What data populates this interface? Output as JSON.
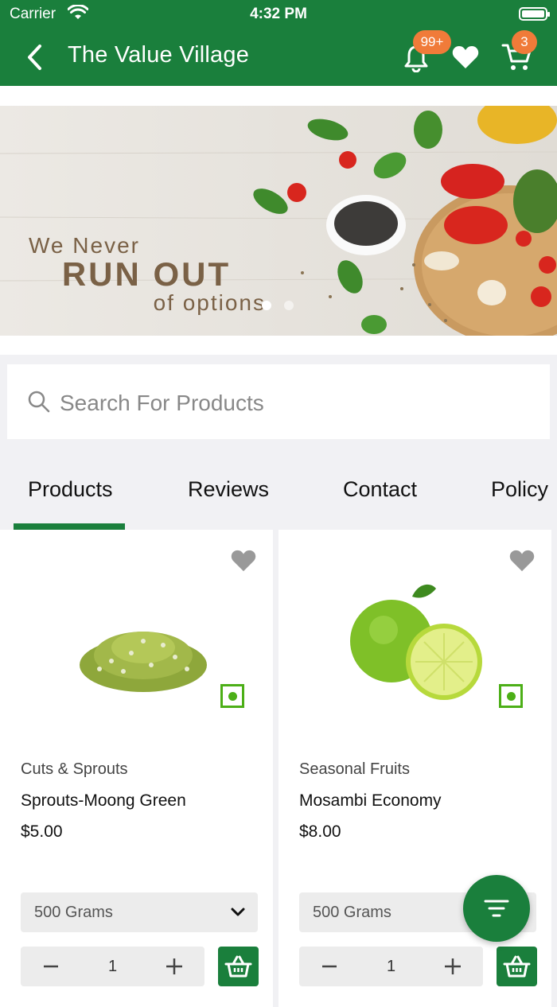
{
  "status_bar": {
    "carrier": "Carrier",
    "time": "4:32 PM"
  },
  "header": {
    "title": "The Value Village",
    "notification_badge": "99+",
    "cart_badge": "3",
    "accent_color": "#1a7f3c",
    "badge_color": "#f07b39"
  },
  "banner": {
    "line1": "We Never",
    "line2": "RUN OUT",
    "line3": "of options",
    "slide_count": 2,
    "active_slide": 1
  },
  "search": {
    "placeholder": "Search For Products"
  },
  "tabs": [
    {
      "label": "Products",
      "active": true
    },
    {
      "label": "Reviews",
      "active": false
    },
    {
      "label": "Contact",
      "active": false
    },
    {
      "label": "Policy",
      "active": false
    }
  ],
  "products": [
    {
      "category": "Cuts & Sprouts",
      "name": "Sprouts-Moong Green",
      "price": "$5.00",
      "variant": "500 Grams",
      "quantity": "1",
      "veg": true,
      "image": "sprouts-image"
    },
    {
      "category": "Seasonal Fruits",
      "name": "Mosambi Economy",
      "price": "$8.00",
      "variant": "500 Grams",
      "quantity": "1",
      "veg": true,
      "image": "mosambi-image"
    }
  ]
}
